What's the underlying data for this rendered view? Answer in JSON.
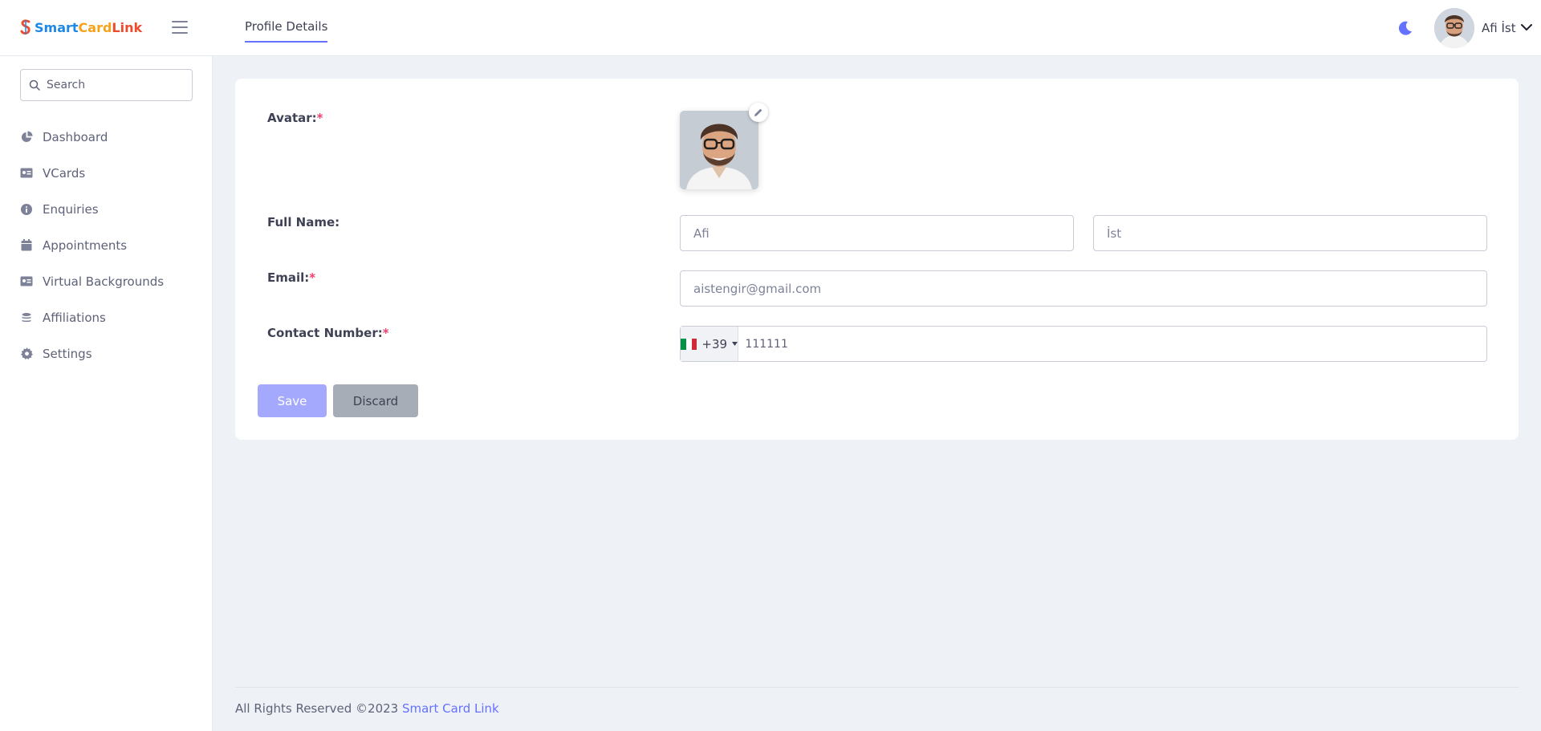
{
  "brand": {
    "part1": "Smart",
    "part2": "Card",
    "part3": "Link"
  },
  "header": {
    "tab_label": "Profile Details",
    "user_name": "Afi İst"
  },
  "sidebar": {
    "search_placeholder": "Search",
    "items": [
      {
        "label": "Dashboard",
        "icon": "pie-chart-icon"
      },
      {
        "label": "VCards",
        "icon": "id-card-icon"
      },
      {
        "label": "Enquiries",
        "icon": "info-circle-icon"
      },
      {
        "label": "Appointments",
        "icon": "calendar-icon"
      },
      {
        "label": "Virtual Backgrounds",
        "icon": "id-card-icon"
      },
      {
        "label": "Affiliations",
        "icon": "coins-stack-icon"
      },
      {
        "label": "Settings",
        "icon": "gear-icon"
      }
    ]
  },
  "form": {
    "avatar_label": "Avatar:",
    "full_name_label": "Full Name:",
    "first_name_value": "Afi",
    "last_name_value": "İst",
    "email_label": "Email:",
    "email_value": "aistengir@gmail.com",
    "contact_label": "Contact Number:",
    "country_code": "+39",
    "phone_value": "111111",
    "required_mark": "*",
    "save_label": "Save",
    "discard_label": "Discard"
  },
  "footer": {
    "text": "All Rights Reserved ©2023 ",
    "link_text": "Smart Card Link"
  },
  "colors": {
    "accent": "#6571ff",
    "required": "#f1416c",
    "save_button": "#a4a9fd",
    "discard_button": "#a6adb6",
    "page_background": "#eef1f6"
  }
}
